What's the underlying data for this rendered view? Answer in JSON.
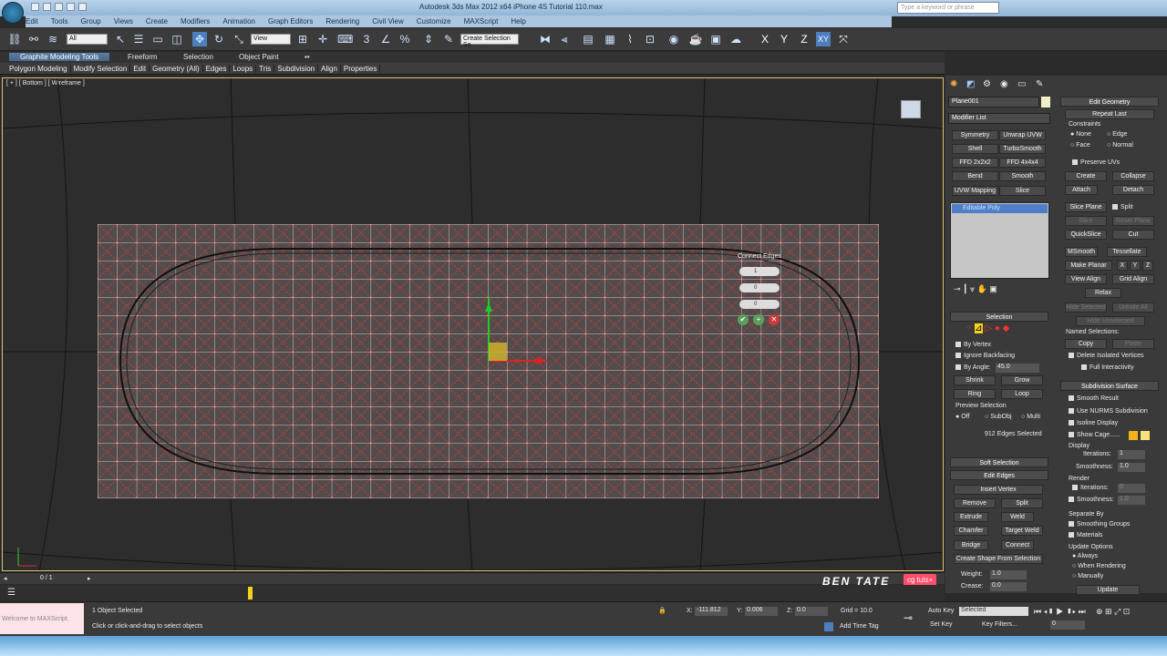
{
  "window": {
    "title": "Autodesk 3ds Max 2012 x64      iPhone 4S Tutorial 110.max",
    "search_placeholder": "Type a keyword or phrase"
  },
  "menu": [
    "Edit",
    "Tools",
    "Group",
    "Views",
    "Create",
    "Modifiers",
    "Animation",
    "Graph Editors",
    "Rendering",
    "Civil View",
    "Customize",
    "MAXScript",
    "Help"
  ],
  "toolbar": {
    "selection_filter": "All",
    "ref_coord": "View",
    "named_sel": "Create Selection Se",
    "num3": "3",
    "axes": [
      "X",
      "Y",
      "Z",
      "XY"
    ]
  },
  "ribbon": {
    "tabs": [
      "Graphite Modeling Tools",
      "Freeform",
      "Selection",
      "Object Paint"
    ],
    "panels": [
      "Polygon Modeling",
      "Modify Selection",
      "Edit",
      "Geometry (All)",
      "Edges",
      "Loops",
      "Tris",
      "Subdivision",
      "Align",
      "Properties"
    ]
  },
  "viewport": {
    "label": "[ + ] [ Bottom ] [ Wireframe ]"
  },
  "caddy": {
    "title": "Connect Edges",
    "values": [
      "1",
      "0",
      "0"
    ]
  },
  "command": {
    "object_name": "Plane001",
    "modifier_list": "Modifier List",
    "buttons": [
      [
        "Symmetry",
        "Unwrap UVW"
      ],
      [
        "Shell",
        "TurboSmooth"
      ],
      [
        "FFD 2x2x2",
        "FFD 4x4x4"
      ],
      [
        "Bend",
        "Smooth"
      ],
      [
        "UVW Mapping Cle",
        "Slice"
      ]
    ],
    "stack_item": "Editable Poly",
    "selection": {
      "title": "Selection",
      "by_vertex": "By Vertex",
      "ignore_backfacing": "Ignore Backfacing",
      "by_angle": "By Angle:",
      "angle_value": "45.0",
      "shrink": "Shrink",
      "grow": "Grow",
      "ring": "Ring",
      "loop": "Loop",
      "preview": "Preview Selection",
      "off": "Off",
      "subobj": "SubObj",
      "multi": "Multi",
      "status": "912 Edges Selected"
    },
    "soft_selection": "Soft Selection",
    "edit_edges": {
      "title": "Edit Edges",
      "insert_vertex": "Insert Vertex",
      "remove": "Remove",
      "split": "Split",
      "extrude": "Extrude",
      "weld": "Weld",
      "chamfer": "Chamfer",
      "target_weld": "Target Weld",
      "bridge": "Bridge",
      "connect": "Connect",
      "create_shape": "Create Shape From Selection",
      "weight_label": "Weight:",
      "weight": "1.0",
      "crease_label": "Crease:",
      "crease": "0.0"
    },
    "edit_geometry": {
      "title": "Edit Geometry",
      "repeat_last": "Repeat Last",
      "constraints": "Constraints",
      "none": "None",
      "edge": "Edge",
      "face": "Face",
      "normal": "Normal",
      "preserve_uvs": "Preserve UVs",
      "create": "Create",
      "collapse": "Collapse",
      "attach": "Attach",
      "detach": "Detach",
      "slice_plane": "Slice Plane",
      "split": "Split",
      "slice": "Slice",
      "reset_plane": "Reset Plane",
      "quickslice": "QuickSlice",
      "cut": "Cut",
      "msmooth": "MSmooth",
      "tessellate": "Tessellate",
      "make_planar": "Make Planar",
      "x": "X",
      "y": "Y",
      "z": "Z",
      "view_align": "View Align",
      "grid_align": "Grid Align",
      "relax": "Relax",
      "hide_selected": "Hide Selected",
      "unhide_all": "Unhide All",
      "hide_unselected": "Hide Unselected",
      "named_selections": "Named Selections:",
      "copy": "Copy",
      "paste": "Paste",
      "delete_isolated": "Delete Isolated Vertices",
      "full_interactivity": "Full Interactivity"
    },
    "subdivision": {
      "title": "Subdivision Surface",
      "smooth_result": "Smooth Result",
      "use_nurms": "Use NURMS Subdivision",
      "isoline": "Isoline Display",
      "show_cage": "Show Cage......",
      "display": "Display",
      "iterations": "Iterations:",
      "iter_val": "1",
      "smoothness": "Smoothness:",
      "smooth_val": "1.0",
      "render": "Render",
      "r_iter": "0",
      "r_smooth": "1.0",
      "separate_by": "Separate By",
      "smoothing_groups": "Smoothing Groups",
      "materials": "Materials",
      "update_options": "Update Options",
      "always": "Always",
      "when_rendering": "When Rendering",
      "manually": "Manually",
      "update": "Update"
    }
  },
  "timeline": {
    "frame": "0 / 1"
  },
  "status": {
    "selected": "1 Object Selected",
    "hint": "Click or click-and-drag to select objects",
    "x_label": "X:",
    "x": "-111.812",
    "y_label": "Y:",
    "y": "0.006",
    "z_label": "Z:",
    "z": "0.0",
    "grid": "Grid = 10.0",
    "add_time_tag": "Add Time Tag",
    "auto_key": "Auto Key",
    "set_key": "Set Key",
    "selected_dd": "Selected",
    "key_filters": "Key Filters...",
    "frame_field": "0",
    "maxscript": "Welcome to MAXScript."
  },
  "watermark": {
    "author": "BEN TATE",
    "brand": "cg tuts+"
  },
  "colors": {
    "grid_line": "#e03a3a",
    "grid_bg": "#534b4b",
    "highlight": "#e2c36f"
  }
}
